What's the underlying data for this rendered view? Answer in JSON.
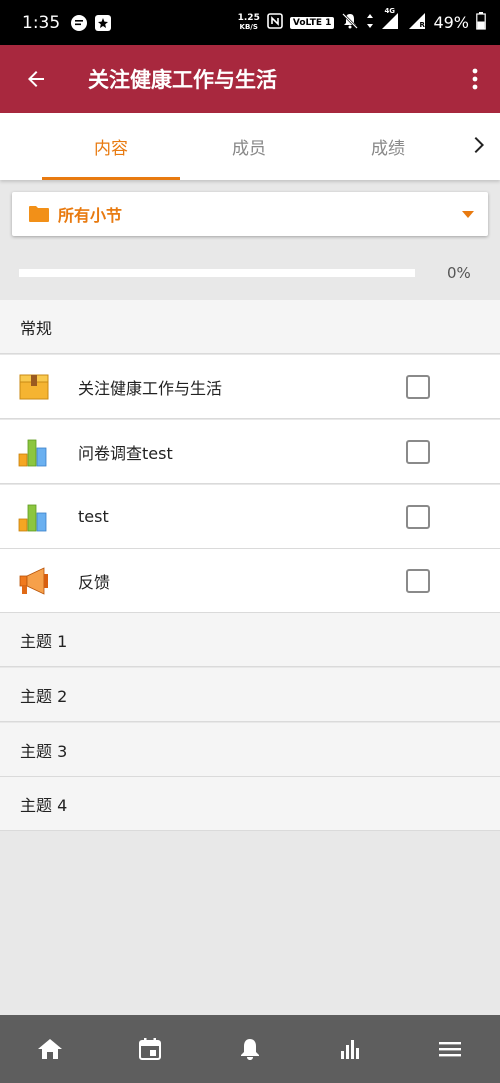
{
  "status_bar": {
    "time": "1:35",
    "net_speed_value": "1.25",
    "net_speed_unit": "KB/S",
    "volte": "VoLTE 1",
    "signal_label": "4G",
    "roaming_mark": "R",
    "battery": "49%"
  },
  "app_bar": {
    "title": "关注健康工作与生活"
  },
  "tabs": [
    {
      "label": "内容",
      "active": true
    },
    {
      "label": "成员",
      "active": false
    },
    {
      "label": "成绩",
      "active": false
    }
  ],
  "section_selector": {
    "label": "所有小节"
  },
  "progress": {
    "value": 0,
    "label": "0%"
  },
  "sections": [
    {
      "title": "常规",
      "activities": [
        {
          "name": "关注健康工作与生活",
          "icon": "package-icon",
          "checked": false
        },
        {
          "name": "问卷调查test",
          "icon": "bar-chart-icon",
          "checked": false
        },
        {
          "name": "test",
          "icon": "bar-chart-icon",
          "checked": false
        },
        {
          "name": "反馈",
          "icon": "megaphone-icon",
          "checked": false
        }
      ]
    },
    {
      "title": "主题 1",
      "activities": []
    },
    {
      "title": "主题 2",
      "activities": []
    },
    {
      "title": "主题 3",
      "activities": []
    },
    {
      "title": "主题 4",
      "activities": []
    }
  ],
  "bottom_nav": [
    {
      "icon": "home-icon"
    },
    {
      "icon": "calendar-icon"
    },
    {
      "icon": "bell-icon"
    },
    {
      "icon": "stats-icon"
    },
    {
      "icon": "menu-icon"
    }
  ],
  "colors": {
    "app_bar": "#a8283e",
    "accent": "#e87a10",
    "bottom_nav": "#5e5e5e"
  }
}
